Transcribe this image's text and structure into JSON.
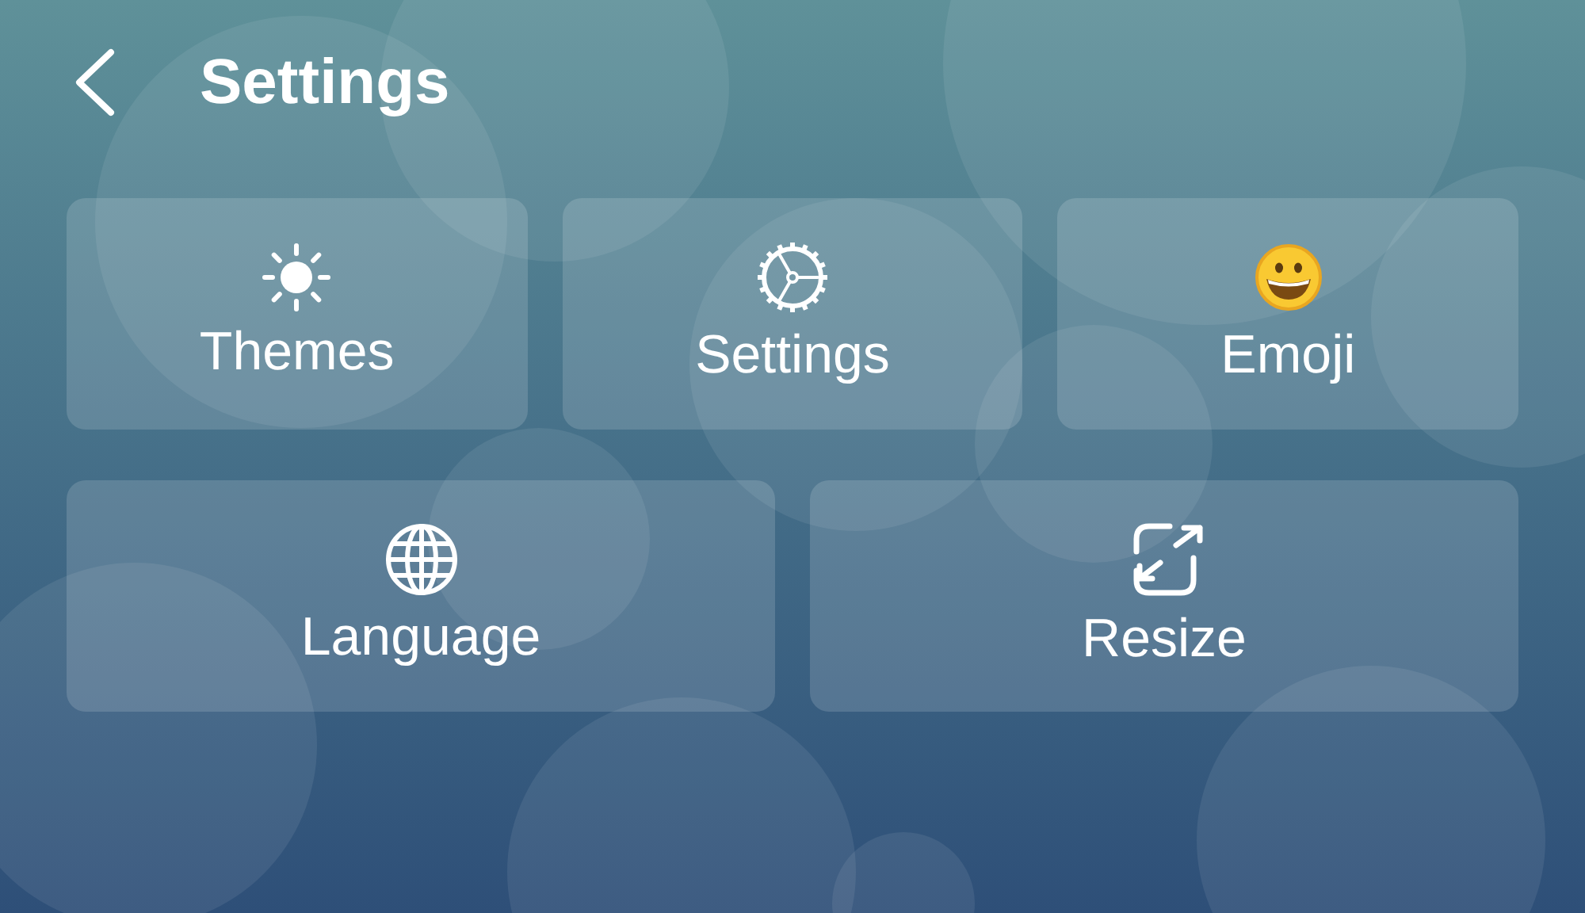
{
  "header": {
    "title": "Settings"
  },
  "tile_rows": [
    [
      {
        "label": "Themes",
        "kind": "sun"
      },
      {
        "label": "Settings",
        "kind": "gear"
      },
      {
        "label": "Emoji",
        "kind": "emoji"
      }
    ],
    [
      {
        "label": "Language",
        "kind": "globe"
      },
      {
        "label": "Resize",
        "kind": "resize"
      }
    ]
  ]
}
